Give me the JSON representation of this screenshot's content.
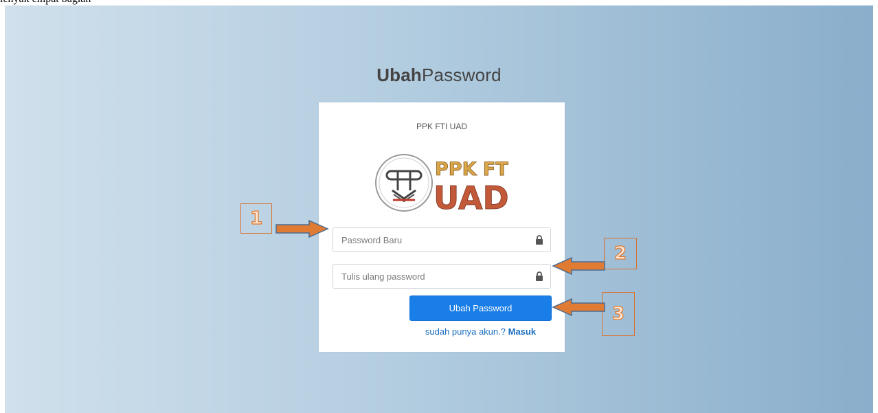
{
  "doc_text": "lenyak empat bagian",
  "page_title": {
    "bold": "Ubah",
    "regular": "Password"
  },
  "card": {
    "org_name": "PPK FTI UAD",
    "logo_text_line1": "PPK FTI",
    "logo_text_line2": "UAD",
    "new_password": {
      "placeholder": "Password Baru",
      "value": ""
    },
    "repeat_password": {
      "placeholder": "Tulis ulang password",
      "value": ""
    },
    "submit_label": "Ubah Password",
    "login_prompt": "sudah punya akun.?",
    "login_link": "Masuk"
  },
  "callouts": [
    "1",
    "2",
    "3"
  ],
  "colors": {
    "accent": "#1a7ee8",
    "link": "#1a6fc1",
    "callout": "#e0782c",
    "logo_gold": "#d9a64a",
    "logo_red": "#c0392b"
  },
  "icons": [
    "lock-icon",
    "arrow-right-icon",
    "arrow-left-icon"
  ]
}
